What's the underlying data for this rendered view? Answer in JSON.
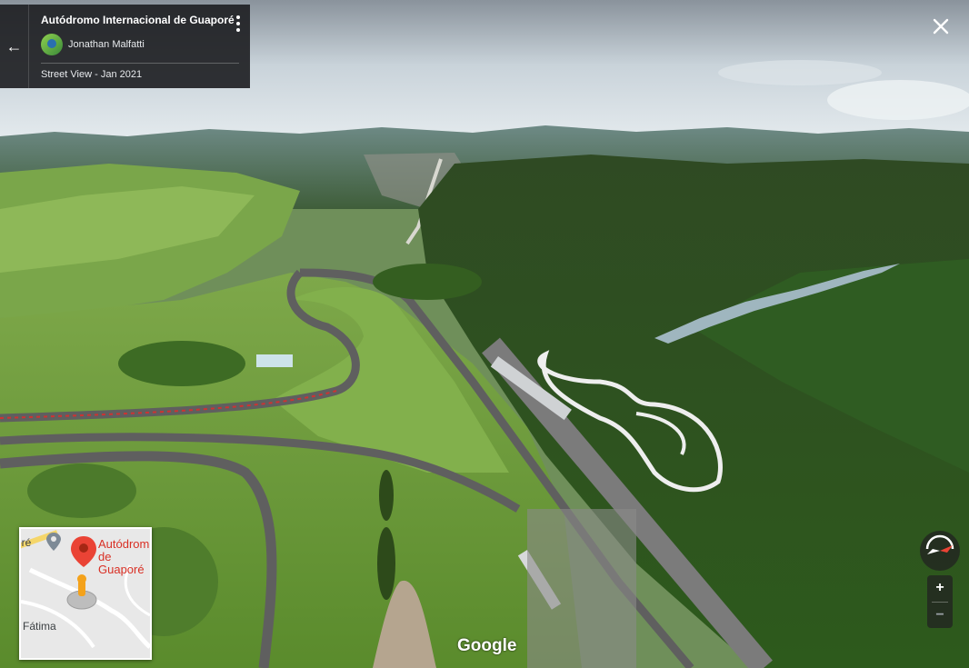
{
  "place": {
    "title": "Autódromo Internacional de Guaporé",
    "author": "Jonathan Malfatti",
    "source_date": "Street View - Jan 2021"
  },
  "icons": {
    "back": "arrow-left-icon",
    "menu": "more-vert-icon",
    "close": "close-icon",
    "compass": "compass-icon",
    "pin": "map-pin-icon",
    "pegman": "pegman-icon"
  },
  "minimap": {
    "place_label": "Autódromo de Guaporé",
    "city_label": "oré",
    "area_label": "Fátima"
  },
  "controls": {
    "zoom_in": "+",
    "zoom_out": "−"
  },
  "branding": {
    "logo": "Google"
  },
  "colors": {
    "panel_bg": "#202124",
    "pin_red": "#ea4335",
    "track_asphalt": "#6b6b6b"
  }
}
